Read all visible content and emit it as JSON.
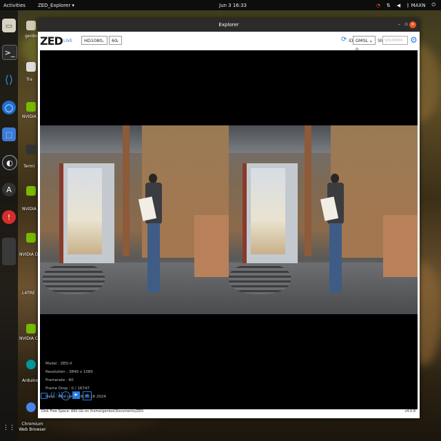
{
  "topbar": {
    "activities": "Activities",
    "app_menu": "ZED_Explorer ▾",
    "clock": "Jun 3  16:33",
    "user": "MAXN"
  },
  "desktop": {
    "items": [
      {
        "label": "genbot"
      },
      {
        "label": "Tra"
      },
      {
        "label": "NVIDIA Jetson"
      },
      {
        "label": "Termi"
      },
      {
        "label": "NVIDIA Jetson S Foru"
      },
      {
        "label": "NVIDIA Develope"
      },
      {
        "label": "L4TRE"
      },
      {
        "label": "NVIDIA Commun"
      },
      {
        "label": "Arduino ID"
      },
      {
        "label": "Chromium Web Browser"
      }
    ]
  },
  "window": {
    "title": "Explorer",
    "logo": "ZED",
    "live": "LIVE",
    "resolution": "HD1080",
    "fps": "60",
    "id_label": "ID",
    "id_value": "GMSL - 0",
    "sn_label": "SN",
    "sn_placeholder": "S/NUMBER"
  },
  "info": {
    "model": "Model : ZED-X",
    "resolution": "Resolution : 3840 x 1080",
    "framerate": "Framerate : 60",
    "frame_drop": "Frame Drop : 0 / 16747",
    "date": "Date : Mon Jun 3 16:33:16 2024"
  },
  "footer": {
    "disk": "Disk Free Space: 860 Gb  on /home/genbot/Documents/ZED",
    "version": "v4.0.8"
  },
  "icons": {
    "bottom": [
      "folder-icon",
      "broadcast-icon",
      "info-icon",
      "video-icon",
      "camera-icon"
    ]
  }
}
